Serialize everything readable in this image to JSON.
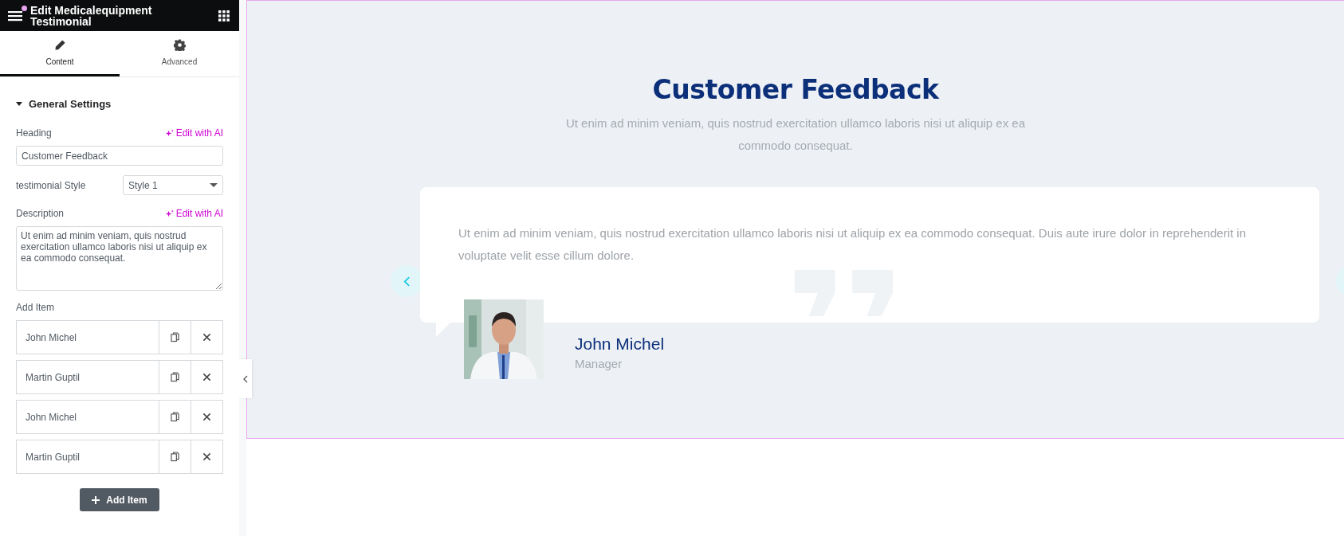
{
  "panel": {
    "title": "Edit Medicalequipment Testimonial",
    "notification": true,
    "tabs": [
      {
        "label": "Content",
        "kind": "pencil",
        "selected": true
      },
      {
        "label": "Advanced",
        "kind": "gear",
        "selected": false
      }
    ],
    "section": {
      "title": "General Settings",
      "expanded": true
    },
    "heading": {
      "label": "Heading",
      "ai_link": "Edit with AI",
      "value": "Customer Feedback"
    },
    "style": {
      "label": "testimonial Style",
      "value": "Style 1"
    },
    "description": {
      "label": "Description",
      "ai_link": "Edit with AI",
      "value": "Ut enim ad minim veniam, quis nostrud exercitation ullamco laboris nisi ut aliquip ex ea commodo consequat."
    },
    "items_label": "Add Item",
    "items": [
      {
        "name": "John Michel"
      },
      {
        "name": "Martin Guptil"
      },
      {
        "name": "John Michel"
      },
      {
        "name": "Martin Guptil"
      }
    ],
    "add_button": "Add Item"
  },
  "canvas": {
    "heading": "Customer Feedback",
    "subtitle": "Ut enim ad minim veniam, quis nostrud exercitation ullamco laboris nisi ut aliquip ex ea commodo consequat.",
    "testimonial": {
      "quote": "Ut enim ad minim veniam, quis nostrud exercitation ullamco laboris nisi ut aliquip ex ea commodo consequat. Duis aute irure dolor in reprehenderit in voluptate velit esse cillum dolore.",
      "name": "John Michel",
      "role": "Manager"
    }
  }
}
